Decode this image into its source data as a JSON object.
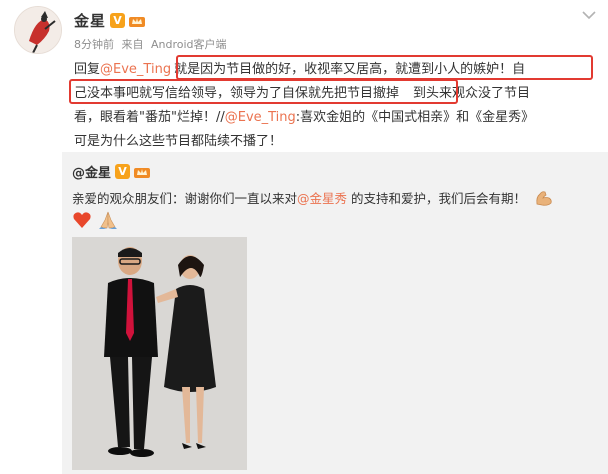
{
  "post": {
    "username": "金星",
    "verified_mark": "V",
    "timestamp": "8分钟前",
    "source_prefix": "来自",
    "source": "Android客户端",
    "text": {
      "reply_prefix": "回复",
      "reply_to": "@Eve_Ting",
      "line1_highlight": "就是因为节目做的好，收视率又居高，就遭到小人的嫉妒！自",
      "line2_highlight": "己没本事吧就写信给领导，领导为了自保就先把节目撤掉",
      "line2_rest": "到头来观众没了节目",
      "line3_a": "看，眼看着\"番茄\"烂掉！//",
      "line3_mention": "@Eve_Ting",
      "line3_b": ":喜欢金姐的《中国式相亲》和《金星秀》",
      "line4": "可是为什么这些节目都陆续不播了！"
    }
  },
  "repost": {
    "author": "@金星",
    "verified_mark": "V",
    "text_a": "亲爱的观众朋友们：谢谢你们一直以来对",
    "mention": "@金星秀",
    "text_b": " 的支持和爱护，我们后会有期！",
    "emoji": [
      "flexed-biceps",
      "heart",
      "praying-hands"
    ]
  },
  "colors": {
    "mention": "#eb7350",
    "highlight_box": "#e23a31",
    "verified_badge": "#f7a21b",
    "repost_background": "#f2f2f2"
  },
  "icons": [
    "chevron-down-icon",
    "verified-icon",
    "crown-badge-icon"
  ]
}
